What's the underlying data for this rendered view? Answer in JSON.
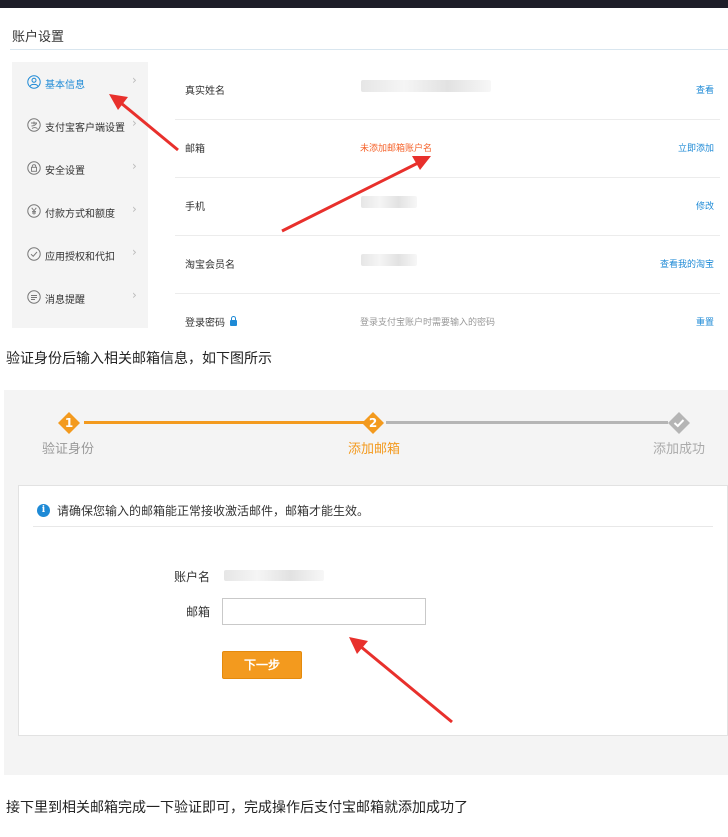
{
  "account": {
    "title": "账户设置",
    "sidebar": [
      {
        "label": "基本信息",
        "icon": "user-icon",
        "active": true
      },
      {
        "label": "支付宝客户端设置",
        "icon": "alipay-icon",
        "active": false
      },
      {
        "label": "安全设置",
        "icon": "lock-icon",
        "active": false
      },
      {
        "label": "付款方式和额度",
        "icon": "yen-icon",
        "active": false
      },
      {
        "label": "应用授权和代扣",
        "icon": "check-circle-icon",
        "active": false
      },
      {
        "label": "消息提醒",
        "icon": "message-icon",
        "active": false
      }
    ],
    "rows": [
      {
        "label": "真实姓名",
        "value": "",
        "action": "查看"
      },
      {
        "label": "邮箱",
        "value": "未添加邮箱账户名",
        "action": "立即添加"
      },
      {
        "label": "手机",
        "value": "",
        "action": "修改"
      },
      {
        "label": "淘宝会员名",
        "value": "",
        "action": "查看我的淘宝"
      },
      {
        "label": "登录密码",
        "value": "登录支付宝账户时需要输入的密码",
        "action": "重置"
      }
    ]
  },
  "caption1": "验证身份后输入相关邮箱信息，如下图所示",
  "add_email": {
    "steps": [
      {
        "num": "1",
        "label": "验证身份",
        "state": "done"
      },
      {
        "num": "2",
        "label": "添加邮箱",
        "state": "current"
      },
      {
        "num": "",
        "label": "添加成功",
        "state": "pending"
      }
    ],
    "notice": "请确保您输入的邮箱能正常接收激活邮件，邮箱才能生效。",
    "account_label": "账户名",
    "email_label": "邮箱",
    "email_value": "",
    "next_label": "下一步"
  },
  "caption2": "接下里到相关邮箱完成一下验证即可，完成操作后支付宝邮箱就添加成功了",
  "colors": {
    "accent_blue": "#1e8ad6",
    "warning_orange": "#f5622a",
    "step_orange": "#f39a1e",
    "arrow_red": "#e8302c",
    "pending_grey": "#b5b5b5"
  }
}
